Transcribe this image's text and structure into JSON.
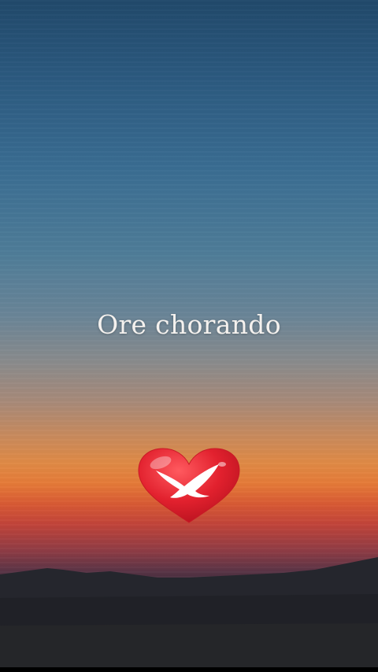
{
  "caption": {
    "text": "Ore chorando"
  },
  "logo": {
    "icon": "heart-dove-icon",
    "heart_color": "#e2212e",
    "dove_color": "#ffffff"
  },
  "colors": {
    "sky_top": "#21496b",
    "horizon_orange": "#e08a45",
    "horizon_red": "#c2443a",
    "ground": "#1e1f26"
  }
}
